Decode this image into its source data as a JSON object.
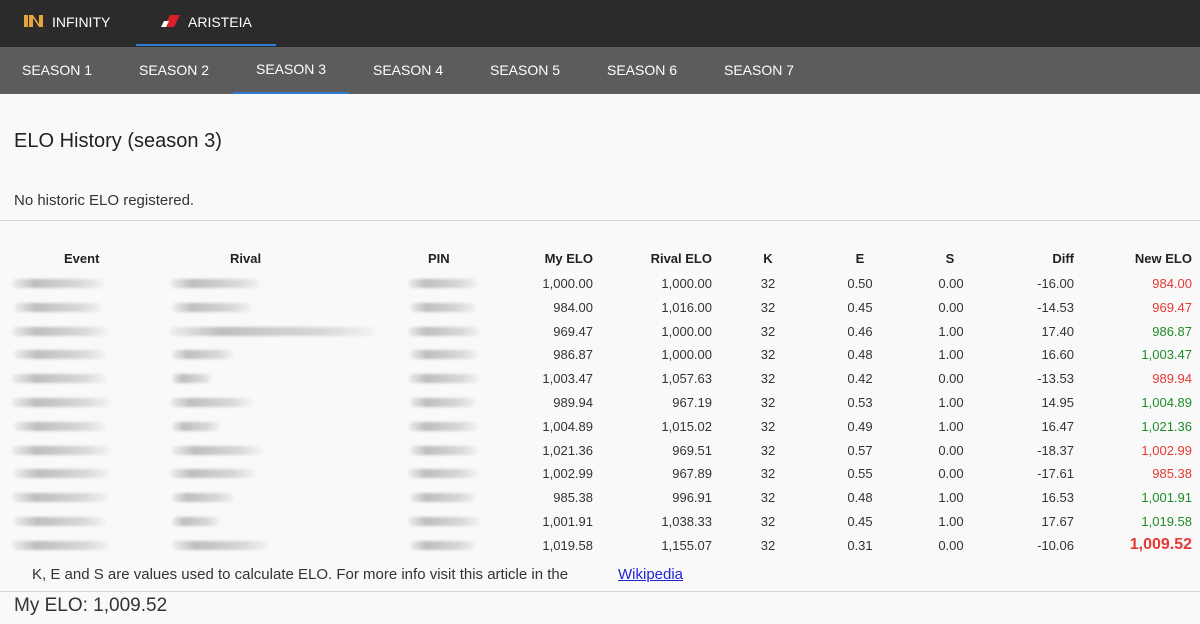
{
  "top_nav": {
    "infinity_label": "INFINITY",
    "aristeia_label": "ARISTEIA"
  },
  "seasons": [
    "SEASON 1",
    "SEASON 2",
    "SEASON 3",
    "SEASON 4",
    "SEASON 5",
    "SEASON 6",
    "SEASON 7"
  ],
  "active_season_index": 2,
  "page": {
    "title": "ELO History (season 3)",
    "no_history": "No historic ELO registered."
  },
  "table": {
    "headers": {
      "event": "Event",
      "rival": "Rival",
      "pin": "PIN",
      "my_elo": "My ELO",
      "rival_elo": "Rival ELO",
      "k": "K",
      "e": "E",
      "s": "S",
      "diff": "Diff",
      "new_elo": "New ELO"
    },
    "rows": [
      {
        "my_elo": "1,000.00",
        "rival_elo": "1,000.00",
        "k": "32",
        "e": "0.50",
        "s": "0.00",
        "diff": "-16.00",
        "new_elo": "984.00",
        "trend": "down"
      },
      {
        "my_elo": "984.00",
        "rival_elo": "1,016.00",
        "k": "32",
        "e": "0.45",
        "s": "0.00",
        "diff": "-14.53",
        "new_elo": "969.47",
        "trend": "down"
      },
      {
        "my_elo": "969.47",
        "rival_elo": "1,000.00",
        "k": "32",
        "e": "0.46",
        "s": "1.00",
        "diff": "17.40",
        "new_elo": "986.87",
        "trend": "up"
      },
      {
        "my_elo": "986.87",
        "rival_elo": "1,000.00",
        "k": "32",
        "e": "0.48",
        "s": "1.00",
        "diff": "16.60",
        "new_elo": "1,003.47",
        "trend": "up"
      },
      {
        "my_elo": "1,003.47",
        "rival_elo": "1,057.63",
        "k": "32",
        "e": "0.42",
        "s": "0.00",
        "diff": "-13.53",
        "new_elo": "989.94",
        "trend": "down"
      },
      {
        "my_elo": "989.94",
        "rival_elo": "967.19",
        "k": "32",
        "e": "0.53",
        "s": "1.00",
        "diff": "14.95",
        "new_elo": "1,004.89",
        "trend": "up"
      },
      {
        "my_elo": "1,004.89",
        "rival_elo": "1,015.02",
        "k": "32",
        "e": "0.49",
        "s": "1.00",
        "diff": "16.47",
        "new_elo": "1,021.36",
        "trend": "up"
      },
      {
        "my_elo": "1,021.36",
        "rival_elo": "969.51",
        "k": "32",
        "e": "0.57",
        "s": "0.00",
        "diff": "-18.37",
        "new_elo": "1,002.99",
        "trend": "down"
      },
      {
        "my_elo": "1,002.99",
        "rival_elo": "967.89",
        "k": "32",
        "e": "0.55",
        "s": "0.00",
        "diff": "-17.61",
        "new_elo": "985.38",
        "trend": "down"
      },
      {
        "my_elo": "985.38",
        "rival_elo": "996.91",
        "k": "32",
        "e": "0.48",
        "s": "1.00",
        "diff": "16.53",
        "new_elo": "1,001.91",
        "trend": "up"
      },
      {
        "my_elo": "1,001.91",
        "rival_elo": "1,038.33",
        "k": "32",
        "e": "0.45",
        "s": "1.00",
        "diff": "17.67",
        "new_elo": "1,019.58",
        "trend": "up"
      },
      {
        "my_elo": "1,019.58",
        "rival_elo": "1,155.07",
        "k": "32",
        "e": "0.31",
        "s": "0.00",
        "diff": "-10.06",
        "new_elo": "1,009.52",
        "trend": "final"
      }
    ]
  },
  "footer": {
    "note": "K, E and S are values used to calculate ELO. For more info visit this article in the",
    "wiki_link": "Wikipedia",
    "my_elo": "My ELO: 1,009.52"
  },
  "colors": {
    "topbar": "#2b2b2b",
    "seasonbar": "#5c5c5c",
    "accent": "#2f7bd6",
    "loss": "#e53935",
    "gain": "#1e8c2a",
    "link": "#2323d6"
  }
}
